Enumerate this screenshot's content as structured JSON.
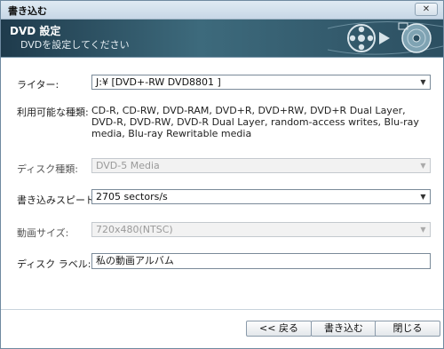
{
  "window": {
    "title": "書き込む",
    "close_label": "✕"
  },
  "banner": {
    "title": "DVD 設定",
    "subtitle": "DVDを設定してください"
  },
  "form": {
    "writer": {
      "label": "ライター:",
      "value": "J:¥ [DVD+-RW DVD8801 ]"
    },
    "types": {
      "label": "利用可能な種類:",
      "value": "CD-R, CD-RW, DVD-RAM, DVD+R, DVD+RW, DVD+R Dual Layer, DVD-R, DVD-RW, DVD-R Dual Layer, random-access writes, Blu-ray media, Blu-ray Rewritable media"
    },
    "disc_type": {
      "label": "ディスク種類:",
      "value": "DVD-5 Media"
    },
    "write_speed": {
      "label": "書き込みスピード:",
      "value": "2705 sectors/s"
    },
    "video_size": {
      "label": "動画サイズ:",
      "value": "720x480(NTSC)"
    },
    "disc_label": {
      "label": "ディスク ラベル:",
      "value": "私の動画アルバム"
    }
  },
  "buttons": {
    "back": "<< 戻る",
    "write": "書き込む",
    "close": "閉じる"
  }
}
